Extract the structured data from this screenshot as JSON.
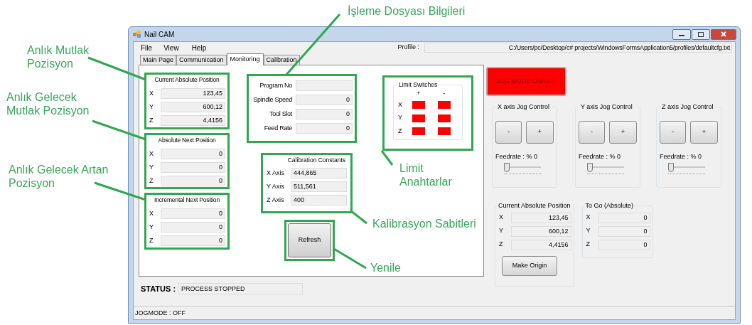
{
  "window": {
    "title": "Nail CAM"
  },
  "menu": [
    "File",
    "View",
    "Help"
  ],
  "profile": {
    "label": "Profile :",
    "value": "C:/Users/pc/Desktop/c# projects/WindowsFormsApplication5/profiles/defaultcfg.txt"
  },
  "tabs": [
    {
      "label": "Main Page",
      "selected": false
    },
    {
      "label": "Communication",
      "selected": false
    },
    {
      "label": "Monitoring",
      "selected": true
    },
    {
      "label": "Calibration",
      "selected": false
    }
  ],
  "current_absolute_position": {
    "title": "Current Absolute Position",
    "rows": [
      {
        "axis": "X",
        "value": "123,45"
      },
      {
        "axis": "Y",
        "value": "600,12"
      },
      {
        "axis": "Z",
        "value": "4,4156"
      }
    ]
  },
  "absolute_next_position": {
    "title": "Absolute Next Position",
    "rows": [
      {
        "axis": "X",
        "value": "0"
      },
      {
        "axis": "Y",
        "value": "0"
      },
      {
        "axis": "Z",
        "value": "0"
      }
    ]
  },
  "incremental_next_position": {
    "title": "Incremental Next Position",
    "rows": [
      {
        "axis": "X",
        "value": "0"
      },
      {
        "axis": "Y",
        "value": "0"
      },
      {
        "axis": "Z",
        "value": "0"
      }
    ]
  },
  "program_info": {
    "rows": [
      {
        "label": "Program No"
      },
      {
        "label": "Spindle Speed",
        "value": "0"
      },
      {
        "label": "Tool Slot",
        "value": "0"
      },
      {
        "label": "Feed Rate",
        "value": "0"
      }
    ]
  },
  "calibration_constants": {
    "title": "Calibration Constants",
    "rows": [
      {
        "label": "X Axis",
        "value": "444,865"
      },
      {
        "label": "Y Axis",
        "value": "511,561"
      },
      {
        "label": "Z Axis",
        "value": "400"
      }
    ]
  },
  "refresh_button": "Refresh",
  "limit_switches": {
    "title": "Limit Switches",
    "columns": [
      "+",
      "-"
    ],
    "rows": [
      {
        "axis": "X",
        "indicators": [
          {
            "color": "#ff0000"
          },
          {
            "color": "#ff0000"
          }
        ]
      },
      {
        "axis": "Y",
        "indicators": [
          {
            "color": "#ff0000"
          },
          {
            "color": "#ff0000"
          }
        ]
      },
      {
        "axis": "Z",
        "indicators": [
          {
            "color": "#ff0000"
          },
          {
            "color": "#ff0000"
          }
        ]
      }
    ]
  },
  "status": {
    "label": "STATUS :",
    "value": "PROCESS STOPPED"
  },
  "jog_mode_button": "JOG MODE ON/OFF",
  "jog_controls": [
    {
      "title": "X axis Jog Control",
      "minus": "-",
      "plus": "+",
      "feedrate": "Feedrate : % 0",
      "level": 0
    },
    {
      "title": "Y axis Jog Control",
      "minus": "-",
      "plus": "+",
      "feedrate": "Feedrate : % 0",
      "level": 0
    },
    {
      "title": "Z axis Jog Control",
      "minus": "-",
      "plus": "+",
      "feedrate": "Feedrate : % 0",
      "level": 0
    }
  ],
  "right_current_position": {
    "title": "Current Absolute Position",
    "rows": [
      {
        "axis": "X",
        "value": "123,45"
      },
      {
        "axis": "Y",
        "value": "600,12"
      },
      {
        "axis": "Z",
        "value": "4,4156"
      }
    ]
  },
  "make_origin_button": "Make Origin",
  "to_go": {
    "title": "To Go (Absolute)",
    "rows": [
      {
        "axis": "X",
        "value": "0"
      },
      {
        "axis": "Y",
        "value": "0"
      },
      {
        "axis": "Z",
        "value": "0"
      }
    ]
  },
  "status_bar": "JOGMODE : OFF",
  "annotations": [
    {
      "text": "Anlık Mutlak Pozisyon"
    },
    {
      "text": "Anlık Gelecek Mutlak Pozisyon"
    },
    {
      "text": "Anlık Gelecek Artan Pozisyon"
    },
    {
      "text": "İşleme Dosyası Bilgileri"
    },
    {
      "text": "Limit Anahtarlar"
    },
    {
      "text": "Kalibrasyon Sabitleri"
    },
    {
      "text": "Yenile"
    }
  ]
}
